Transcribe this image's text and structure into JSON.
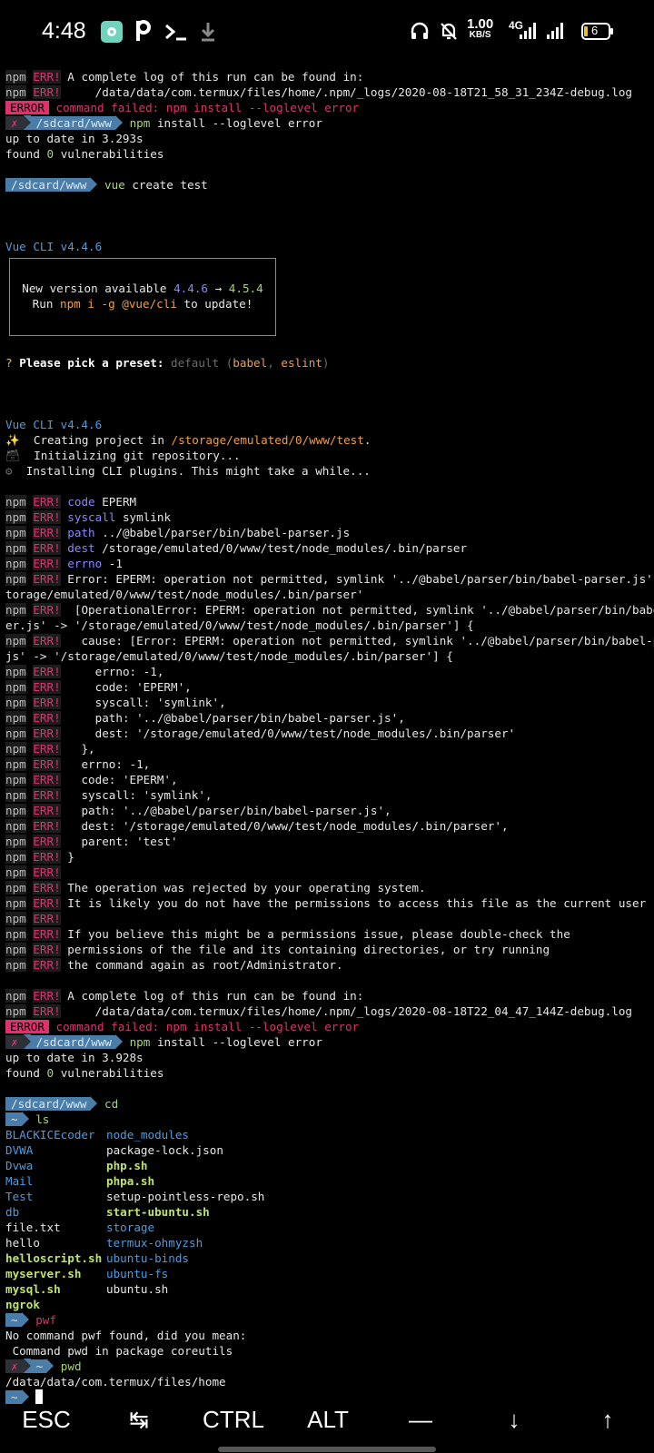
{
  "status_bar": {
    "time": "4:48",
    "net_speed_value": "1.00",
    "net_speed_unit": "KB/S",
    "network_type": "4G",
    "battery_level": "6"
  },
  "terminal": {
    "npm": "npm",
    "err": "ERR!",
    "l01": "A complete log of this run can be found in:",
    "l02": "    /data/data/com.termux/files/home/.npm/_logs/2020-08-18T21_58_31_234Z-debug.log",
    "error_badge": "ERROR",
    "failed_msg": "command failed: npm install --loglevel error",
    "x_mark": "✗",
    "prompt_sdcard": "/sdcard/www",
    "prompt_home": "~",
    "cmd_npm": "npm",
    "cmd_npm_args": "install --loglevel error",
    "up_to_date_1": "up to date in 3.293s",
    "found_pre": "found",
    "found_num": "0",
    "found_post": "vulnerabilities",
    "cmd_vue": "vue",
    "cmd_vue_args": "create test",
    "vue_cli": "Vue CLI v4.4.6",
    "new_version": "New version available",
    "ver_old": "4.4.6",
    "ver_arrow": "→",
    "ver_new": "4.5.4",
    "run_pre": "Run",
    "run_cmd": "npm i -g @vue/cli",
    "run_post": "to update!",
    "q_mark": "?",
    "pick_preset": "Please pick a preset:",
    "preset_default": "default",
    "preset_open": "(",
    "preset_babel": "babel",
    "preset_comma": ",",
    "preset_eslint": "eslint",
    "preset_close": ")",
    "sparkle": "✨",
    "creating": "Creating project in",
    "project_path": "/storage/emulated/0/www/test",
    "dot": ".",
    "init_icon": "🗃",
    "init_git": "Initializing git repository...",
    "gear": "⚙",
    "installing": "Installing CLI plugins. This might take a while...",
    "code_key": "code",
    "code_val": "EPERM",
    "syscall_key": "syscall",
    "syscall_val": "symlink",
    "path_key": "path",
    "path_val": "../@babel/parser/bin/babel-parser.js",
    "dest_key": "dest",
    "dest_val": "/storage/emulated/0/www/test/node_modules/.bin/parser",
    "errno_key": "errno",
    "errno_val": "-1",
    "e1": "Error: EPERM: operation not permitted, symlink '../@babel/parser/bin/babel-parser.js' -> '/s",
    "e2": "torage/emulated/0/www/test/node_modules/.bin/parser'",
    "e3": " [OperationalError: EPERM: operation not permitted, symlink '../@babel/parser/bin/babel-pars",
    "e4": "er.js' -> '/storage/emulated/0/www/test/node_modules/.bin/parser'] {",
    "e5": "  cause: [Error: EPERM: operation not permitted, symlink '../@babel/parser/bin/babel-parser.",
    "e6": "js' -> '/storage/emulated/0/www/test/node_modules/.bin/parser'] {",
    "e7": "    errno: -1,",
    "e8": "    code: 'EPERM',",
    "e9": "    syscall: 'symlink',",
    "e10": "    path: '../@babel/parser/bin/babel-parser.js',",
    "e11": "    dest: '/storage/emulated/0/www/test/node_modules/.bin/parser'",
    "e12": "  },",
    "e13": "  errno: -1,",
    "e14": "  code: 'EPERM',",
    "e15": "  syscall: 'symlink',",
    "e16": "  path: '../@babel/parser/bin/babel-parser.js',",
    "e17": "  dest: '/storage/emulated/0/www/test/node_modules/.bin/parser',",
    "e18": "  parent: 'test'",
    "e19": "}",
    "e20": "The operation was rejected by your operating system.",
    "e21": "It is likely you do not have the permissions to access this file as the current user",
    "e22": "If you believe this might be a permissions issue, please double-check the",
    "e23": "permissions of the file and its containing directories, or try running",
    "e24": "the command again as root/Administrator.",
    "l2_02": "    /data/data/com.termux/files/home/.npm/_logs/2020-08-18T22_04_47_144Z-debug.log",
    "up_to_date_2": "up to date in 3.928s",
    "cmd_cd": "cd",
    "cmd_ls": "ls",
    "ls_rows": [
      {
        "a": "BLACKICEcoder",
        "b": "node_modules"
      },
      {
        "a": "DVWA",
        "b": "package-lock.json"
      },
      {
        "a": "Dvwa",
        "b": "php.sh"
      },
      {
        "a": "Mail",
        "b": "phpa.sh"
      },
      {
        "a": "Test",
        "b": "setup-pointless-repo.sh"
      },
      {
        "a": "db",
        "b": "start-ubuntu.sh"
      },
      {
        "a": "file.txt",
        "b": "storage"
      },
      {
        "a": "hello",
        "b": "termux-ohmyzsh"
      },
      {
        "a": "helloscript.sh",
        "b": "ubuntu-binds"
      },
      {
        "a": "myserver.sh",
        "b": "ubuntu-fs"
      },
      {
        "a": "mysql.sh",
        "b": "ubuntu.sh"
      },
      {
        "a": "ngrok",
        "b": ""
      }
    ],
    "cmd_pwf": "pwf",
    "no_cmd": "No command pwf found, did you mean:",
    "suggest": " Command pwd in package coreutils",
    "cmd_pwd": "pwd",
    "pwd_out": "/data/data/com.termux/files/home"
  },
  "extra_keys": {
    "esc": "ESC",
    "tab": "↹",
    "ctrl": "CTRL",
    "alt": "ALT",
    "dash": "—",
    "down": "↓",
    "up": "↑"
  },
  "colors": {
    "error": "#e0306f",
    "prompt_blue": "#4a7ea8",
    "dir_blue": "#4f9bdc",
    "exec_green": "#bfe36c"
  }
}
